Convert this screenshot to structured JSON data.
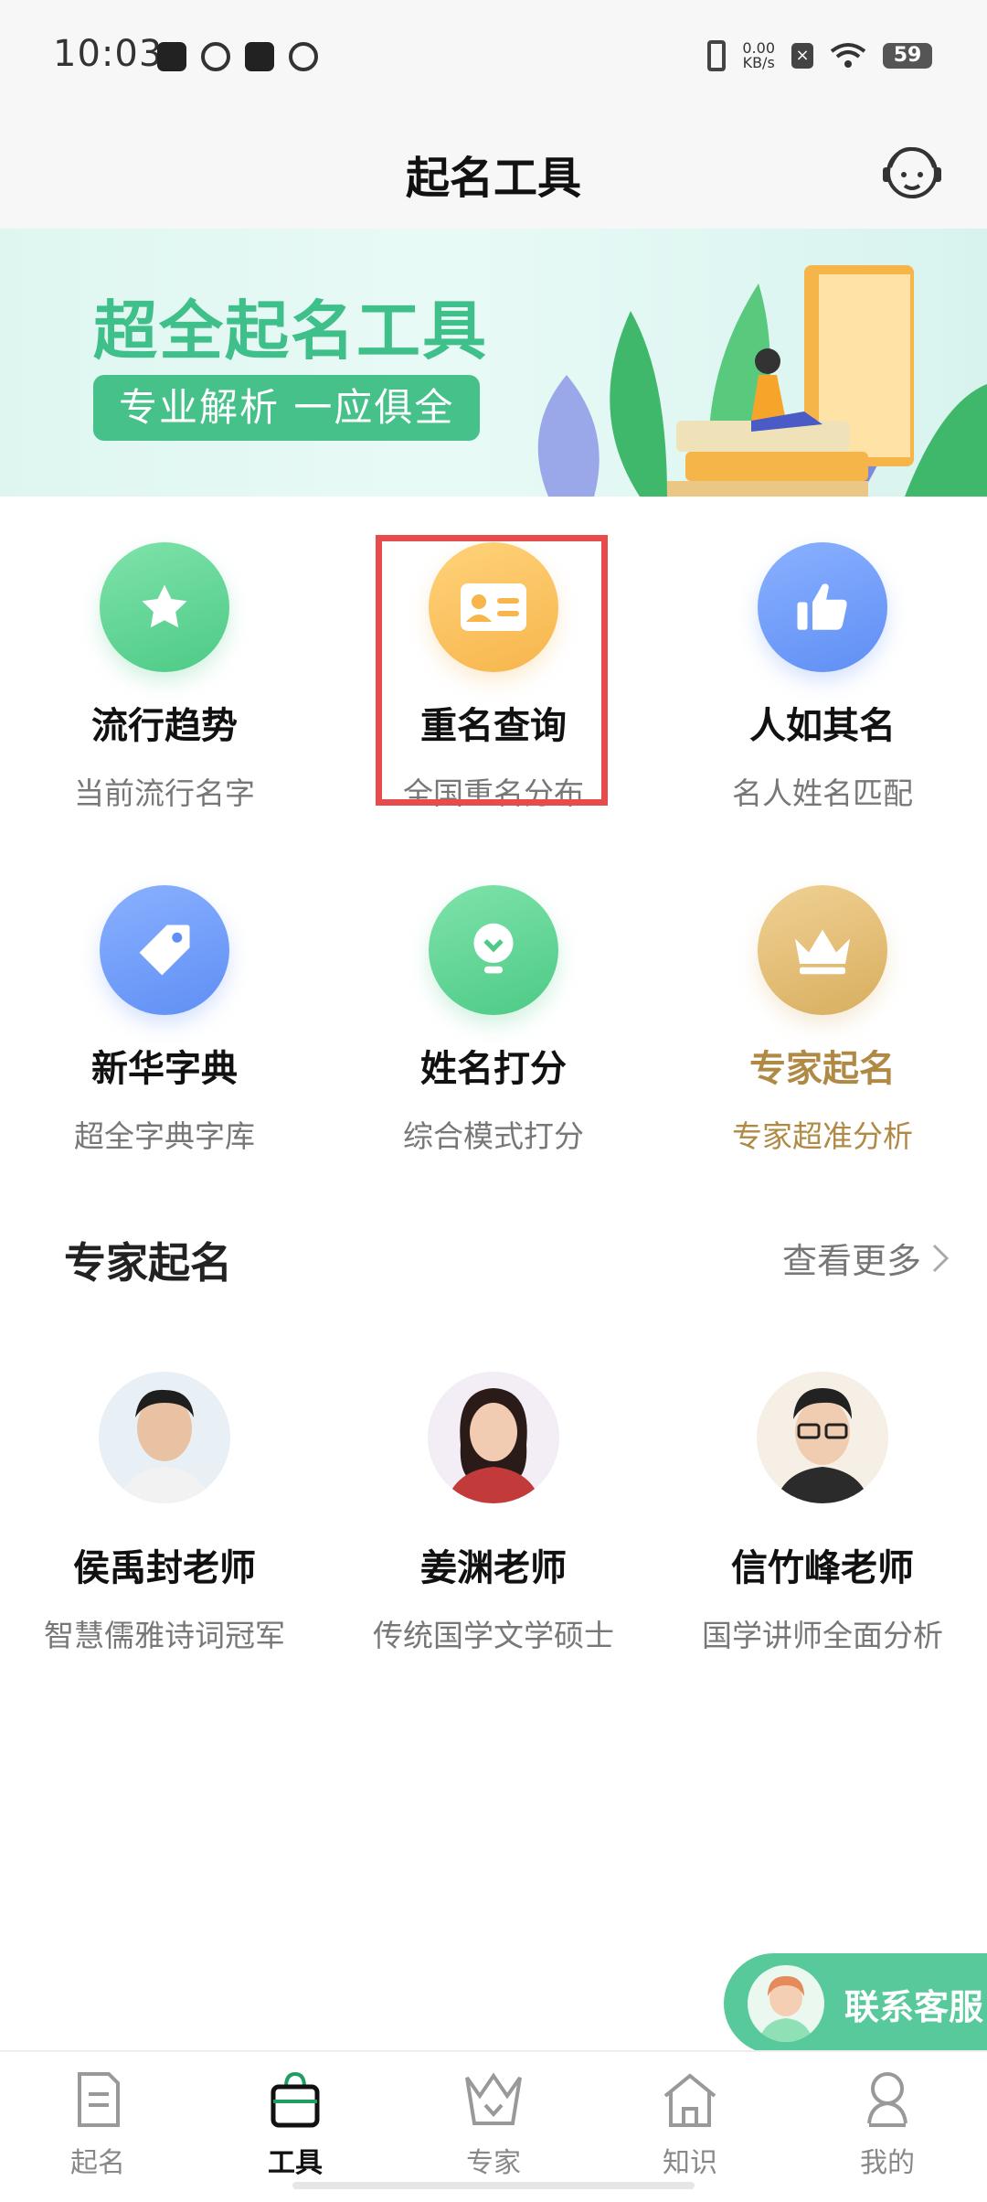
{
  "status_bar": {
    "time": "10:03",
    "net_speed_value": "0.00",
    "net_speed_unit": "KB/s",
    "battery": "59"
  },
  "header": {
    "title": "起名工具",
    "service_icon": "headset-agent-icon"
  },
  "banner": {
    "title": "超全起名工具",
    "subtitle": "专业解析  一应俱全"
  },
  "tools": [
    {
      "title": "流行趋势",
      "subtitle": "当前流行名字",
      "icon": "star-icon",
      "color": "#4dca86"
    },
    {
      "title": "重名查询",
      "subtitle": "全国重名分布",
      "icon": "id-card-icon",
      "color": "#f7b54c"
    },
    {
      "title": "人如其名",
      "subtitle": "名人姓名匹配",
      "icon": "thumbs-up-icon",
      "color": "#5f8ff5"
    },
    {
      "title": "新华字典",
      "subtitle": "超全字典字库",
      "icon": "tag-icon",
      "color": "#5f8ff5"
    },
    {
      "title": "姓名打分",
      "subtitle": "综合模式打分",
      "icon": "lightbulb-icon",
      "color": "#4dca86"
    },
    {
      "title": "专家起名",
      "subtitle": "专家超准分析",
      "icon": "crown-icon",
      "color": "#d8ae5f"
    }
  ],
  "experts_section": {
    "title": "专家起名",
    "more": "查看更多"
  },
  "experts": [
    {
      "name": "侯禹封老师",
      "subtitle": "智慧儒雅诗词冠军"
    },
    {
      "name": "姜渊老师",
      "subtitle": "传统国学文学硕士"
    },
    {
      "name": "信竹峰老师",
      "subtitle": "国学讲师全面分析"
    }
  ],
  "floating_service": {
    "label": "联系客服"
  },
  "tabbar": [
    {
      "label": "起名",
      "icon": "document-icon",
      "active": false
    },
    {
      "label": "工具",
      "icon": "bag-icon",
      "active": true
    },
    {
      "label": "专家",
      "icon": "crown-icon",
      "active": false
    },
    {
      "label": "知识",
      "icon": "home-icon",
      "active": false
    },
    {
      "label": "我的",
      "icon": "person-icon",
      "active": false
    }
  ],
  "colors": {
    "accent": "#46c18a",
    "highlight_box": "#e84b4b",
    "gold_text": "#b08a45"
  }
}
